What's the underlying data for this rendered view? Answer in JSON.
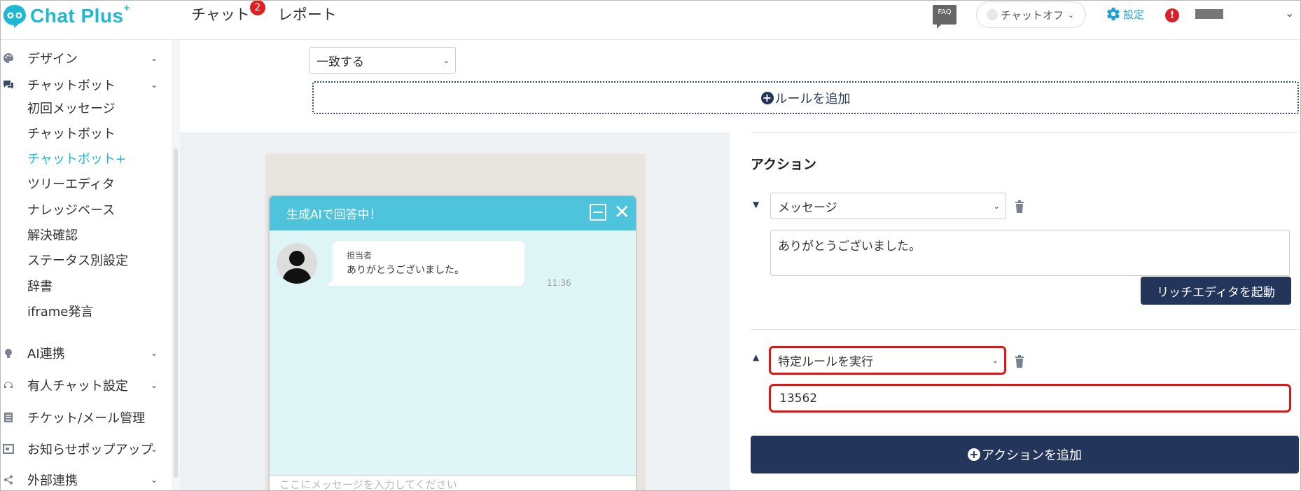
{
  "app": {
    "logo_text": "Chat Plus",
    "logo_sup": "+",
    "colors": {
      "accent": "#1fb8d3",
      "navy": "#23355a",
      "highlight_red": "#e01515",
      "chat_header": "#4ec3dc",
      "chat_bg": "#def5f5"
    }
  },
  "topnav": {
    "chat_label": "チャット",
    "chat_badge": "2",
    "report_label": "レポート",
    "faq_label": "FAQ",
    "chat_status_label": "チャットオフ",
    "settings_label": "設定",
    "alert_label": "!"
  },
  "sidebar": {
    "design": "デザイン",
    "chatbot": "チャットボット",
    "chatbot_sub": [
      "初回メッセージ",
      "チャットボット",
      "チャットボット+",
      "ツリーエディタ",
      "ナレッジベース",
      "解決確認",
      "ステータス別設定",
      "辞書",
      "iframe発言"
    ],
    "ai": "AI連携",
    "manned": "有人チャット設定",
    "ticket": "チケット/メール管理",
    "popup": "お知らせポップアップ",
    "external": "外部連携"
  },
  "rule": {
    "match_select": "一致する",
    "add_rule_label": "ルールを追加"
  },
  "preview": {
    "header_title": "生成AIで回答中！",
    "sender": "担当者",
    "message": "ありがとうございました。",
    "time": "11:36",
    "input_placeholder": "ここにメッセージを入力してください"
  },
  "actions": {
    "title": "アクション",
    "action1_type": "メッセージ",
    "action1_text": "ありがとうございました。",
    "rich_editor_label": "リッチエディタを起動",
    "action2_type": "特定ルールを実行",
    "action2_value": "13562",
    "add_action_label": "アクションを追加"
  }
}
